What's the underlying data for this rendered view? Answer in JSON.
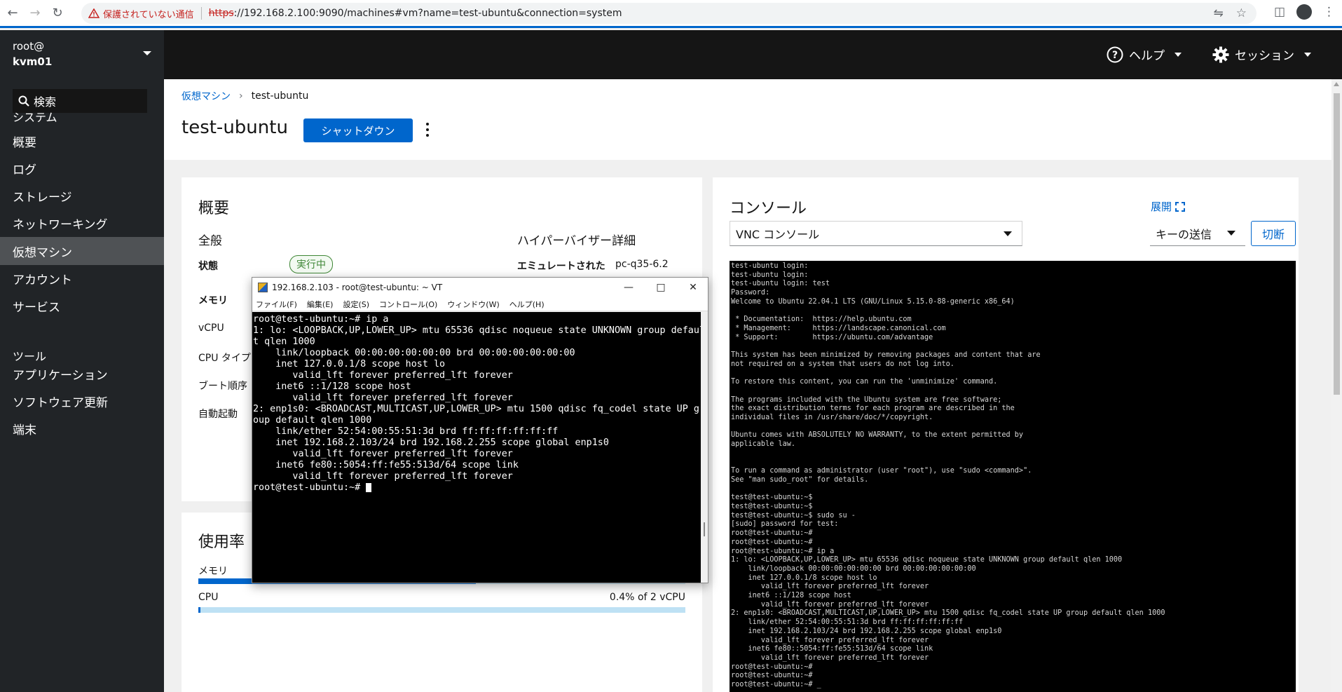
{
  "browser": {
    "security_warning": "保護されていない通信",
    "url_scheme": "https",
    "url_rest": "://192.168.2.100:9090/machines#vm?name=test-ubuntu&connection=system"
  },
  "sidebar": {
    "user": "root@",
    "host": "kvm01",
    "search_label": "検索",
    "section_system": "システム",
    "items_system": [
      {
        "label": "概要"
      },
      {
        "label": "ログ"
      },
      {
        "label": "ストレージ"
      },
      {
        "label": "ネットワーキング"
      },
      {
        "label": "仮想マシン"
      },
      {
        "label": "アカウント"
      },
      {
        "label": "サービス"
      }
    ],
    "section_tools": "ツール",
    "items_tools": [
      {
        "label": "アプリケーション"
      },
      {
        "label": "ソフトウェア更新"
      },
      {
        "label": "端末"
      }
    ]
  },
  "topbar": {
    "help_label": "ヘルプ",
    "session_label": "セッション"
  },
  "page": {
    "breadcrumb_parent": "仮想マシン",
    "breadcrumb_current": "test-ubuntu",
    "title": "test-ubuntu",
    "shutdown_label": "シャットダウン"
  },
  "overview": {
    "title": "概要",
    "general_title": "全般",
    "hypervisor_title": "ハイパーバイザー詳細",
    "state_label": "状態",
    "state_value": "実行中",
    "memory_label": "メモリ",
    "vcpu_label": "vCPU",
    "cputype_label": "CPU タイプ",
    "boot_label": "ブート順序",
    "autostart_label": "自動起動",
    "emulated_label": "エミュレートされた",
    "emulated_value": "pc-q35-6.2"
  },
  "usage": {
    "title": "使用率",
    "memory_label": "メモリ",
    "memory_fraction": 0.57,
    "cpu_label": "CPU",
    "cpu_value": "0.4% of 2 vCPU",
    "cpu_fraction": 0.004
  },
  "console": {
    "title": "コンソール",
    "expand_label": "展開",
    "type_selected": "VNC コンソール",
    "send_key_label": "キーの送信",
    "disconnect_label": "切断",
    "screen_text": "test-ubuntu login:\ntest-ubuntu login:\ntest-ubuntu login: test\nPassword:\nWelcome to Ubuntu 22.04.1 LTS (GNU/Linux 5.15.0-88-generic x86_64)\n\n * Documentation:  https://help.ubuntu.com\n * Management:     https://landscape.canonical.com\n * Support:        https://ubuntu.com/advantage\n\nThis system has been minimized by removing packages and content that are\nnot required on a system that users do not log into.\n\nTo restore this content, you can run the 'unminimize' command.\n\nThe programs included with the Ubuntu system are free software;\nthe exact distribution terms for each program are described in the\nindividual files in /usr/share/doc/*/copyright.\n\nUbuntu comes with ABSOLUTELY NO WARRANTY, to the extent permitted by\napplicable law.\n\n\nTo run a command as administrator (user \"root\"), use \"sudo <command>\".\nSee \"man sudo_root\" for details.\n\ntest@test-ubuntu:~$\ntest@test-ubuntu:~$\ntest@test-ubuntu:~$ sudo su -\n[sudo] password for test:\nroot@test-ubuntu:~#\nroot@test-ubuntu:~#\nroot@test-ubuntu:~# ip a\n1: lo: <LOOPBACK,UP,LOWER_UP> mtu 65536 qdisc noqueue state UNKNOWN group default qlen 1000\n    link/loopback 00:00:00:00:00:00 brd 00:00:00:00:00:00\n    inet 127.0.0.1/8 scope host lo\n       valid_lft forever preferred_lft forever\n    inet6 ::1/128 scope host\n       valid_lft forever preferred_lft forever\n2: enp1s0: <BROADCAST,MULTICAST,UP,LOWER_UP> mtu 1500 qdisc fq_codel state UP group default qlen 1000\n    link/ether 52:54:00:55:51:3d brd ff:ff:ff:ff:ff:ff\n    inet 192.168.2.103/24 brd 192.168.2.255 scope global enp1s0\n       valid_lft forever preferred_lft forever\n    inet6 fe80::5054:ff:fe55:513d/64 scope link\n       valid_lft forever preferred_lft forever\nroot@test-ubuntu:~#\nroot@test-ubuntu:~#\nroot@test-ubuntu:~# _"
  },
  "teraterm": {
    "title": "192.168.2.103 - root@test-ubuntu: ~ VT",
    "menu": [
      "ファイル(F)",
      "編集(E)",
      "設定(S)",
      "コントロール(O)",
      "ウィンドウ(W)",
      "ヘルプ(H)"
    ],
    "terminal_text": "root@test-ubuntu:~# ip a\n1: lo: <LOOPBACK,UP,LOWER_UP> mtu 65536 qdisc noqueue state UNKNOWN group defaul\nt qlen 1000\n    link/loopback 00:00:00:00:00:00 brd 00:00:00:00:00:00\n    inet 127.0.0.1/8 scope host lo\n       valid_lft forever preferred_lft forever\n    inet6 ::1/128 scope host\n       valid_lft forever preferred_lft forever\n2: enp1s0: <BROADCAST,MULTICAST,UP,LOWER_UP> mtu 1500 qdisc fq_codel state UP gr\noup default qlen 1000\n    link/ether 52:54:00:55:51:3d brd ff:ff:ff:ff:ff:ff\n    inet 192.168.2.103/24 brd 192.168.2.255 scope global enp1s0\n       valid_lft forever preferred_lft forever\n    inet6 fe80::5054:ff:fe55:513d/64 scope link\n       valid_lft forever preferred_lft forever",
    "prompt": "root@test-ubuntu:~# "
  }
}
